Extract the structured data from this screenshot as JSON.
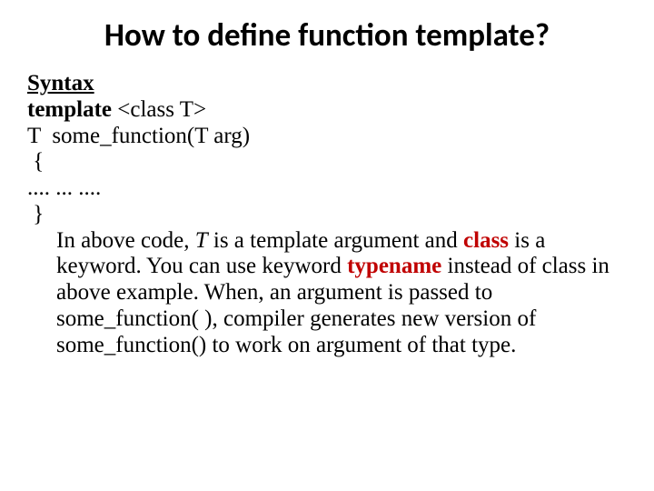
{
  "title": "How to define function template?",
  "syntax_label": "Syntax",
  "code": {
    "l1a": "template ",
    "l1b": "<class T>",
    "l2": "T  some_function(T arg)",
    "l3": " {",
    "l4": ".... ... ....",
    "l5": " }"
  },
  "para": {
    "p1": "In above code, ",
    "T": "T",
    "p2": " is a template argument and ",
    "kw_class": "class",
    "p3": " is a keyword. You can use keyword ",
    "kw_typename": "typename",
    "p4": " instead of class in above example. When, an argument is passed to some_function( ), compiler generates new version of some_function() to work on argument of that type."
  }
}
